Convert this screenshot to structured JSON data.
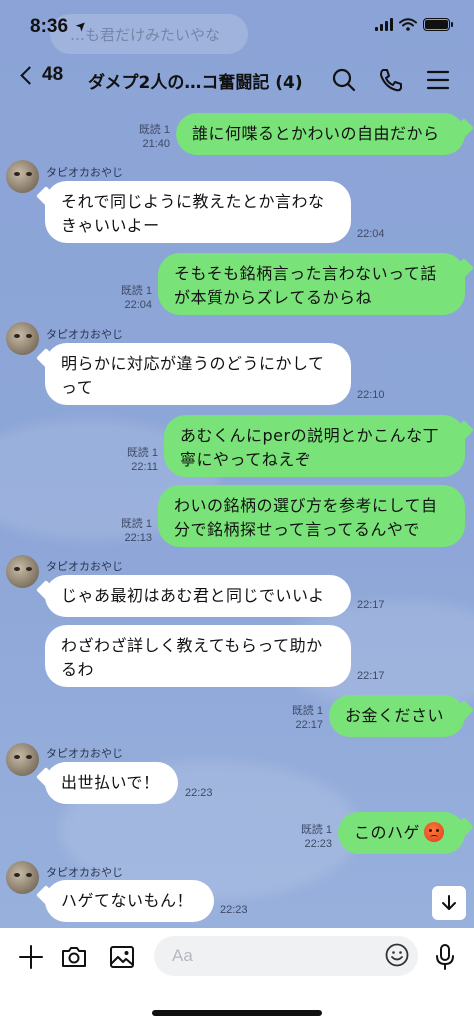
{
  "status_bar": {
    "time": "8:36",
    "location_glyph": "➤"
  },
  "faded_preview": "…も君だけみたいやな",
  "header": {
    "back_count": "48",
    "title": "ダメプ2人の…コ奮闘記 (4)"
  },
  "messages": [
    {
      "from": "me",
      "read": "既読 1",
      "time": "21:40",
      "text": "誰に何喋るとかわいの自由だから"
    },
    {
      "from": "them",
      "sender": "タピオカおやじ",
      "time": "22:04",
      "lines": [
        "それで同じように教えたとか言わな",
        "きゃいいよー"
      ]
    },
    {
      "from": "me",
      "read": "既読 1",
      "time": "22:04",
      "lines": [
        "そもそも銘柄言った言わないって話",
        "が本質からズレてるからね"
      ]
    },
    {
      "from": "them",
      "sender": "タピオカおやじ",
      "time": "22:10",
      "lines": [
        "明らかに対応が違うのどうにかして",
        "って"
      ]
    },
    {
      "from": "me",
      "read": "既読 1",
      "time": "22:11",
      "lines": [
        "あむくんにperの説明とかこんな丁",
        "寧にやってねえぞ"
      ]
    },
    {
      "from": "me",
      "read": "既読 1",
      "time": "22:13",
      "lines": [
        "わいの銘柄の選び方を参考にして自",
        "分で銘柄探せって言ってるんやで"
      ]
    },
    {
      "from": "them",
      "sender": "タピオカおやじ",
      "time": "22:17",
      "text": "じゃあ最初はあむ君と同じでいいよ"
    },
    {
      "from": "them",
      "time": "22:17",
      "lines": [
        "わざわざ詳しく教えてもらって助か",
        "るわ"
      ]
    },
    {
      "from": "me",
      "read": "既読 1",
      "time": "22:17",
      "text": "お金ください"
    },
    {
      "from": "them",
      "sender": "タピオカおやじ",
      "time": "22:23",
      "text": "出世払いで！"
    },
    {
      "from": "me",
      "read": "既読 1",
      "time": "22:23",
      "text": "このハゲ",
      "emoji": "angry-face"
    },
    {
      "from": "them",
      "sender": "タピオカおやじ",
      "time": "22:23",
      "text": "ハゲてないもん！"
    }
  ],
  "composer": {
    "placeholder": "Aa"
  },
  "colors": {
    "my_bubble": "#79e278",
    "their_bubble": "#ffffff",
    "chat_background": "#8ba3d6"
  },
  "icons": [
    "back-chevron-icon",
    "search-icon",
    "phone-icon",
    "menu-icon",
    "plus-icon",
    "camera-icon",
    "image-icon",
    "emoji-icon",
    "microphone-icon",
    "arrow-down-icon"
  ]
}
